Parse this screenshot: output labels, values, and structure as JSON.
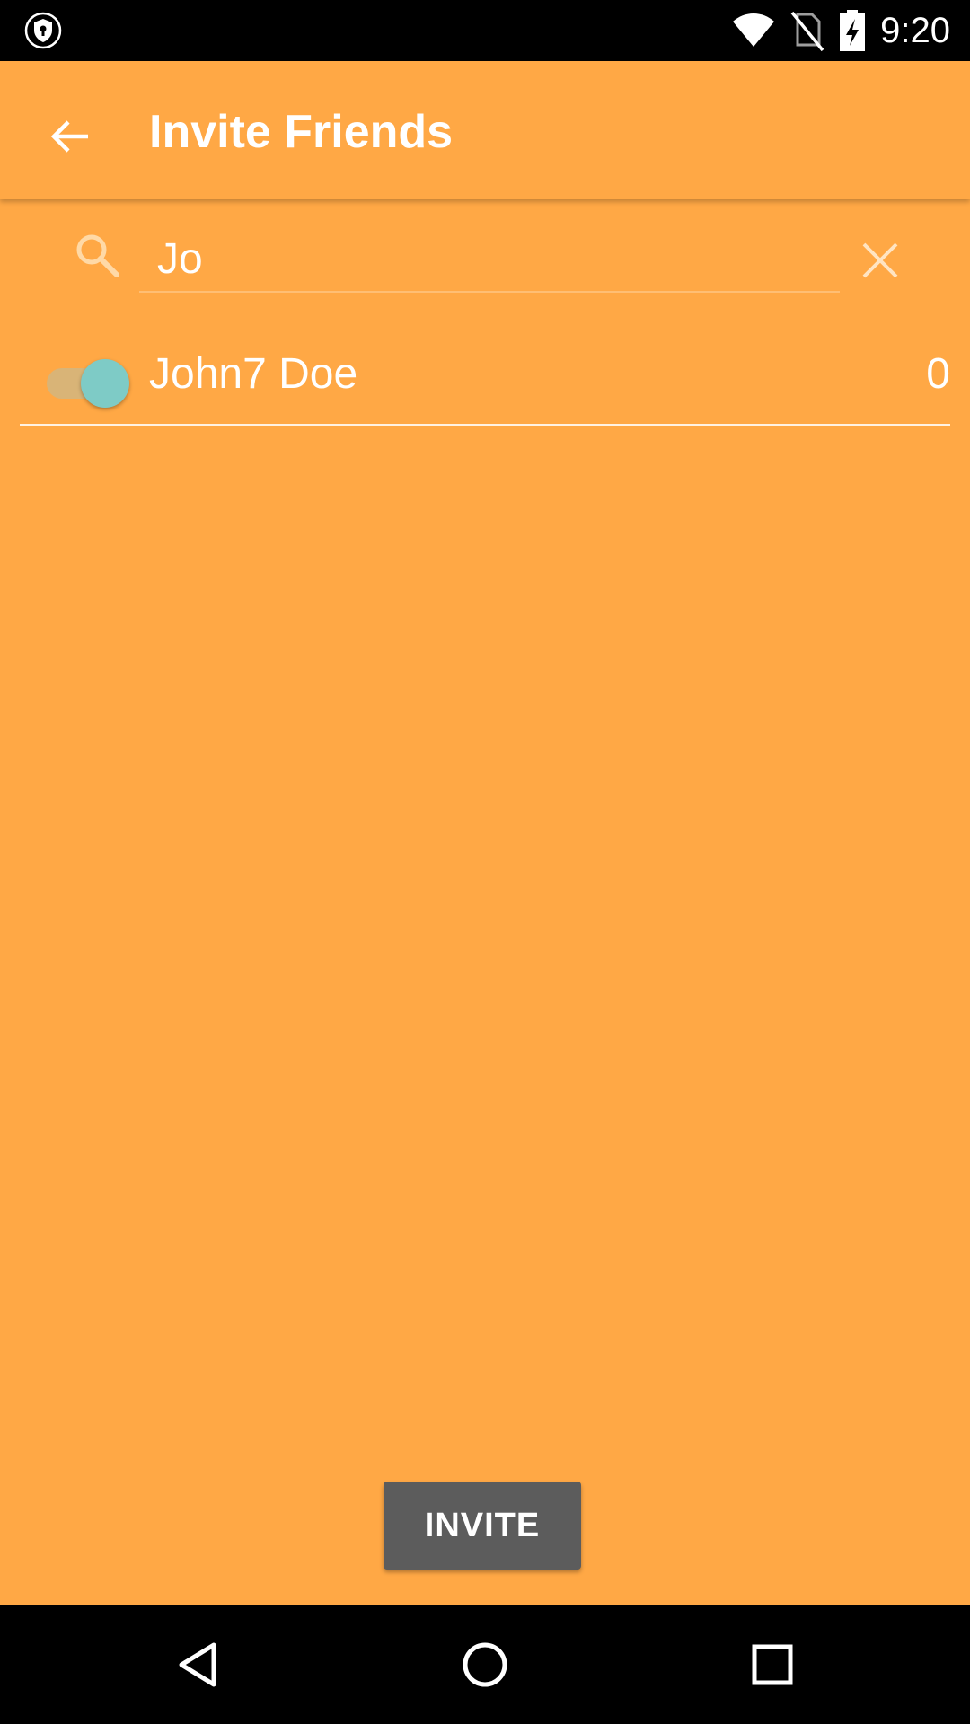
{
  "status_bar": {
    "time": "9:20",
    "icons": [
      "shield-icon",
      "wifi-icon",
      "no-sim-icon",
      "battery-charging-icon"
    ]
  },
  "app_bar": {
    "title": "Invite Friends",
    "back_icon": "arrow-left-icon"
  },
  "search": {
    "value": "Jo",
    "search_icon": "search-icon",
    "clear_icon": "close-icon"
  },
  "friends": [
    {
      "name": "John7 Doe",
      "count": "0",
      "selected": true
    }
  ],
  "invite_button": {
    "label": "INVITE"
  },
  "nav_bar": {
    "icons": [
      "back-triangle-icon",
      "home-circle-icon",
      "recents-square-icon"
    ]
  },
  "colors": {
    "background": "#FFA845",
    "toggle_thumb": "#7ECBC6",
    "toggle_track": "#D9B477",
    "button": "#5C5C5C",
    "bars": "#000000"
  }
}
